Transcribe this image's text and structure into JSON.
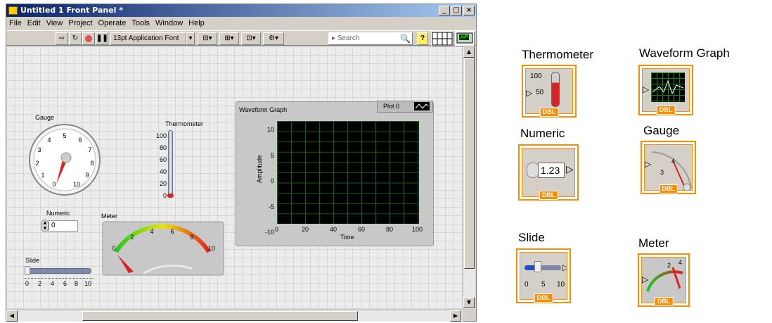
{
  "window": {
    "title": "Untitled 1 Front Panel *"
  },
  "menu": [
    "File",
    "Edit",
    "View",
    "Project",
    "Operate",
    "Tools",
    "Window",
    "Help"
  ],
  "toolbar": {
    "font": "13pt Application Font",
    "search_placeholder": "Search"
  },
  "controls": {
    "gauge": {
      "label": "Gauge",
      "ticks": [
        "0",
        "1",
        "2",
        "3",
        "4",
        "5",
        "6",
        "7",
        "8",
        "9",
        "10"
      ]
    },
    "thermometer": {
      "label": "Thermometer",
      "ticks": [
        "100",
        "80",
        "60",
        "40",
        "20",
        "0"
      ]
    },
    "numeric": {
      "label": "Numeric",
      "value": "0"
    },
    "meter": {
      "label": "Meter",
      "ticks": [
        "0",
        "2",
        "4",
        "6",
        "8",
        "10"
      ]
    },
    "slide": {
      "label": "Slide",
      "ticks": [
        "0",
        "2",
        "4",
        "6",
        "8",
        "10"
      ]
    },
    "graph": {
      "label": "Waveform Graph",
      "legend": "Plot 0",
      "ylabel": "Amplitude",
      "xlabel": "Time",
      "yticks": [
        "10",
        "5",
        "0",
        "-5",
        "-10"
      ],
      "xticks": [
        "0",
        "20",
        "40",
        "60",
        "80",
        "100"
      ]
    }
  },
  "terminals": {
    "thermometer": {
      "label": "Thermometer",
      "badge": "DBL",
      "ticks": [
        "100",
        "50"
      ]
    },
    "graph": {
      "label": "Waveform Graph",
      "badge": "DBL"
    },
    "numeric": {
      "label": "Numeric",
      "badge": "DBL",
      "value": "1.23"
    },
    "gauge": {
      "label": "Gauge",
      "badge": "DBL"
    },
    "slide": {
      "label": "Slide",
      "badge": "DBL",
      "ticks": [
        "0",
        "5",
        "10"
      ]
    },
    "meter": {
      "label": "Meter",
      "badge": "DBL"
    }
  }
}
